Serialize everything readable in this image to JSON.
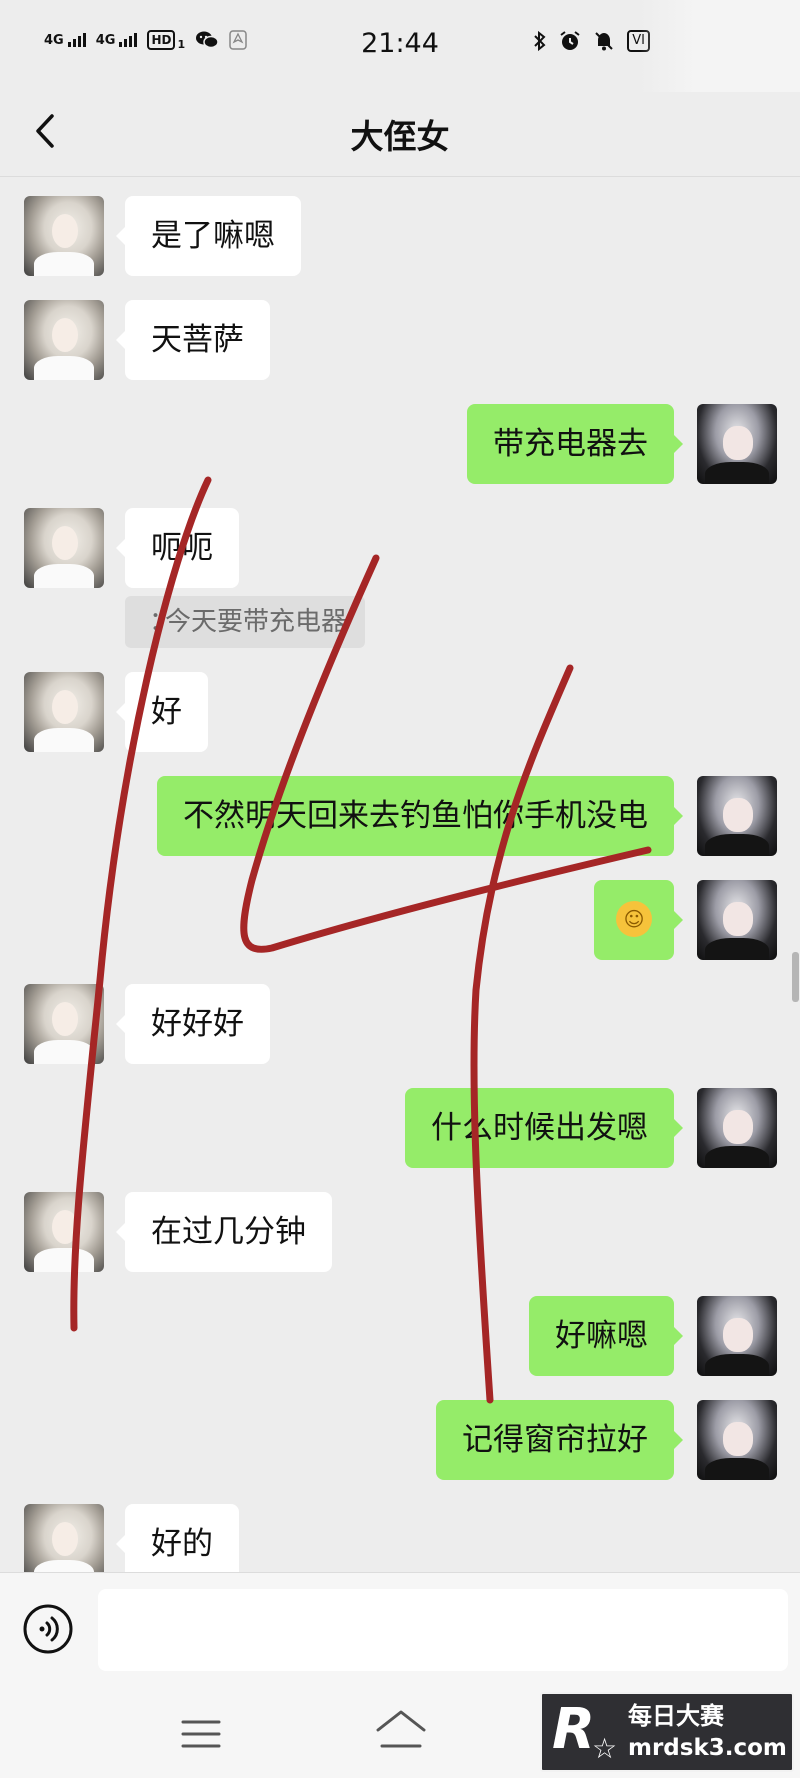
{
  "status_bar": {
    "network_1": "4G",
    "network_2": "4G",
    "hd_label": "HD",
    "hd_sub": "1",
    "time": "21:44",
    "volte_label": "VI"
  },
  "header": {
    "title": "大侄女"
  },
  "messages": [
    {
      "side": "left",
      "text": "是了嘛嗯"
    },
    {
      "side": "left",
      "text": "天菩萨"
    },
    {
      "side": "right",
      "text": "带充电器去"
    },
    {
      "side": "left",
      "text": "呃呃",
      "quote": "今天要带充电器"
    },
    {
      "side": "left",
      "text": "好"
    },
    {
      "side": "right",
      "text": "不然明天回来去钓鱼怕你手机没电"
    },
    {
      "side": "right",
      "emoji": "face-with-tears-of-joy"
    },
    {
      "side": "left",
      "text": "好好好"
    },
    {
      "side": "right",
      "text": "什么时候出发嗯"
    },
    {
      "side": "left",
      "text": "在过几分钟"
    },
    {
      "side": "right",
      "text": "好嘛嗯"
    },
    {
      "side": "right",
      "text": "记得窗帘拉好"
    },
    {
      "side": "left",
      "text": "好的"
    }
  ],
  "quote_mark": "：",
  "input_bar": {
    "message_value": "",
    "voice_icon": "voice-icon"
  },
  "colors": {
    "outgoing_bubble": "#95ec69",
    "incoming_bubble": "#ffffff",
    "background": "#ededed",
    "handwriting": "#a52626"
  },
  "watermark": {
    "logo_letter": "R",
    "title": "每日大赛",
    "url": "mrdsk3.com"
  }
}
